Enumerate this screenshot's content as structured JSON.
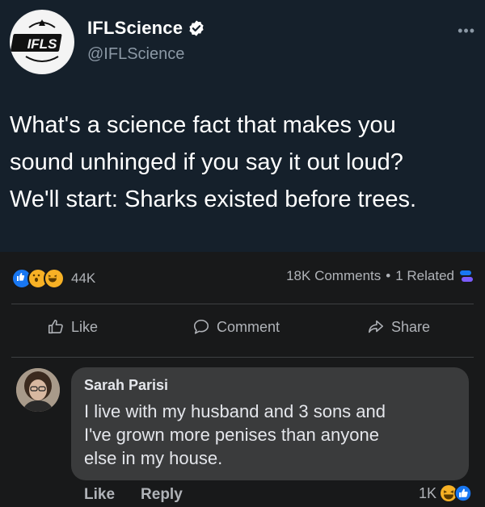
{
  "tweet": {
    "avatar_text": "IFLS",
    "display_name": "IFLScience",
    "handle": "@IFLScience",
    "more_icon": "more-icon",
    "text_lines": [
      "What's a science fact that makes you",
      "sound unhinged if you say it out loud?",
      "We'll start: Sharks existed before trees."
    ]
  },
  "post": {
    "reaction_count": "44K",
    "comments": "18K Comments",
    "separator": "•",
    "related": "1 Related",
    "actions": {
      "like": "Like",
      "comment": "Comment",
      "share": "Share"
    }
  },
  "comment": {
    "author": "Sarah Parisi",
    "text_lines": [
      "I live with my husband and 3 sons and",
      "I've grown more penises than anyone",
      "else in my house."
    ],
    "like": "Like",
    "reply": "Reply",
    "reaction_count": "1K"
  },
  "colors": {
    "tweet_bg": "#15202b",
    "fb_bg": "#18191a",
    "bubble_bg": "#3a3b3c",
    "fb_blue": "#1877f2",
    "twitter_blue": "#1d9bf0"
  }
}
